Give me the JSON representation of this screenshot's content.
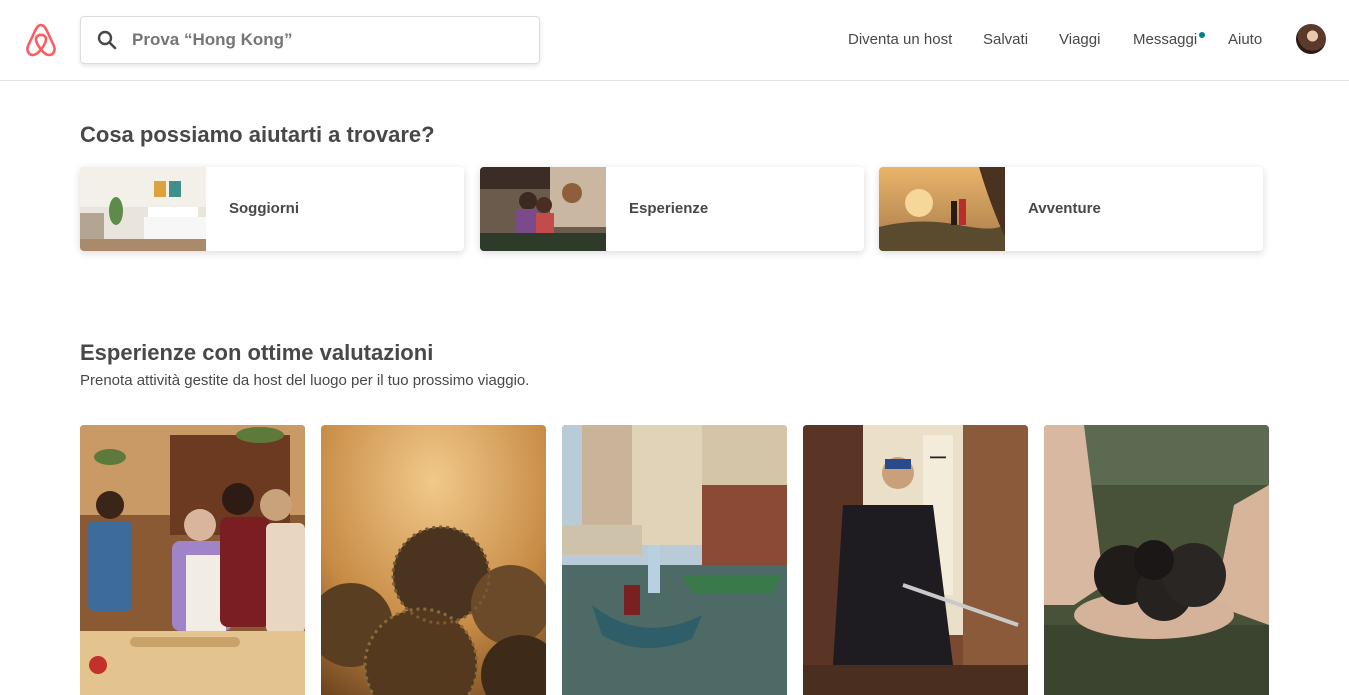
{
  "header": {
    "search": {
      "placeholder": "Prova “Hong Kong”"
    },
    "nav": [
      {
        "label": "Diventa un host"
      },
      {
        "label": "Salvati"
      },
      {
        "label": "Viaggi"
      },
      {
        "label": "Messaggi"
      },
      {
        "label": "Aiuto"
      }
    ],
    "brand_color": "#FF5A5F",
    "notification_color": "#008489"
  },
  "find": {
    "title": "Cosa possiamo aiutarti a trovare?",
    "categories": [
      {
        "label": "Soggiorni",
        "icon": "bedroom-photo"
      },
      {
        "label": "Esperienze",
        "icon": "cooking-photo"
      },
      {
        "label": "Avventure",
        "icon": "hiking-photo"
      }
    ]
  },
  "experiences": {
    "title": "Esperienze con ottime valutazioni",
    "subtitle": "Prenota attività gestite da host del luogo per il tuo prossimo viaggio."
  }
}
